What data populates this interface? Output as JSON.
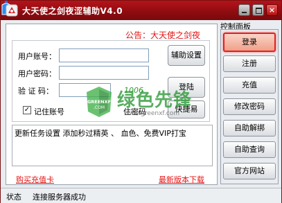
{
  "window": {
    "title": "大天使之剑夜涩辅助V4.0",
    "close_label": "×"
  },
  "notice": "公告：大天使之剑夜",
  "login": {
    "username_label": "用户账号：",
    "username_value": "",
    "password_label": "用户密码：",
    "password_value": "",
    "captcha_label": "验 证 码：",
    "captcha_value": "",
    "captcha_text": "1006",
    "settings_button": "辅助设置",
    "login_button": "登陆",
    "quick_button": "快捷易",
    "remember_account": "记住账号",
    "remember_checked": "✓",
    "remember_password": "住密码"
  },
  "news": "更新任务设置  添加秒过精英 、 血色、免费VIP打宝",
  "links": {
    "buy_card": "购买充值卡",
    "latest_version": "最新版本下载"
  },
  "control_panel": {
    "title": "控制面板",
    "buttons": [
      "登录",
      "注册",
      "充值",
      "修改密码",
      "自助解绑",
      "自助查询",
      "官方网站"
    ],
    "active_index": 0
  },
  "status": {
    "label": "状态",
    "text": "连接服务器成功"
  },
  "watermark": {
    "big": "绿色先锋",
    "logo_text": "GREENXF",
    "logo_sub": ".COM",
    "url": "www.greenxf.com"
  },
  "colors": {
    "titlebar": "#9c0e13",
    "notice": "#e31414",
    "link": "#e31414",
    "accent_active": "#dd2222"
  }
}
